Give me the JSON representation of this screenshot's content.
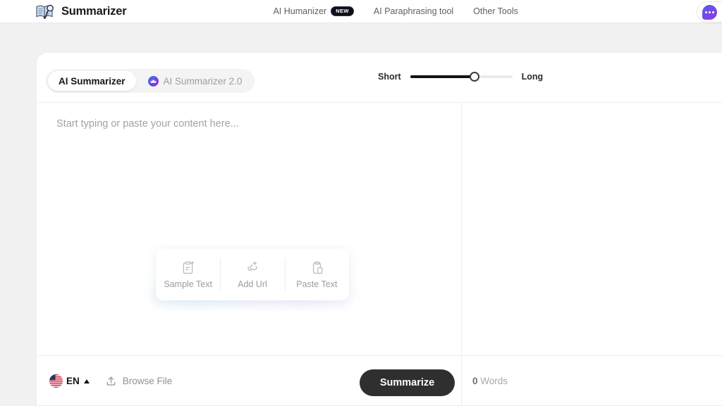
{
  "header": {
    "brand_title": "Summarizer",
    "logo_icon": "book-search-icon",
    "nav": [
      {
        "label": "AI Humanizer",
        "badge": "NEW"
      },
      {
        "label": "AI Paraphrasing tool",
        "badge": ""
      },
      {
        "label": "Other Tools",
        "badge": ""
      }
    ],
    "chat_icon": "chat-bubble-icon"
  },
  "toolbar": {
    "tabs": [
      {
        "label": "AI Summarizer",
        "active": true,
        "icon": ""
      },
      {
        "label": "AI Summarizer 2.0",
        "active": false,
        "icon": "sparkle-crown-icon"
      }
    ],
    "length": {
      "min_label": "Short",
      "max_label": "Long",
      "value_percent": 63
    }
  },
  "editor": {
    "placeholder": "Start typing or paste your content here...",
    "value": "",
    "actions": [
      {
        "label": "Sample Text",
        "icon": "clipboard-plus-icon"
      },
      {
        "label": "Add Url",
        "icon": "link-plus-icon"
      },
      {
        "label": "Paste Text",
        "icon": "paste-icon"
      }
    ]
  },
  "footer": {
    "language_code": "EN",
    "language_flag": "us-flag-icon",
    "language_caret": "caret-up-icon",
    "browse_label": "Browse File",
    "browse_icon": "upload-icon",
    "summarize_label": "Summarize",
    "word_count": "0",
    "word_count_unit": "Words"
  },
  "colors": {
    "page_background": "#f1f1f1",
    "card_background": "#ffffff",
    "accent_dark": "#2f2f2f",
    "muted_text": "#9a9da1",
    "badge_dark": "#0d0f1a",
    "chat_gradient_start": "#5b5bf0",
    "chat_gradient_end": "#8a3ae0"
  }
}
